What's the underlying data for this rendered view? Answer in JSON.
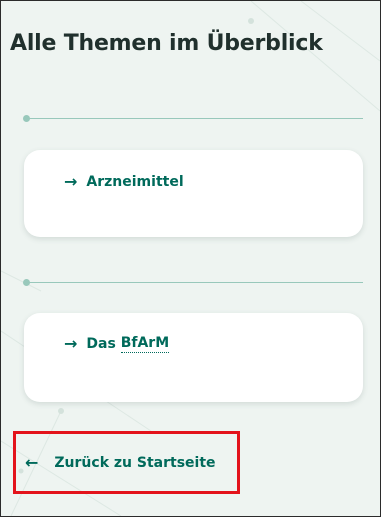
{
  "title": "Alle Themen im Überblick",
  "cards": [
    {
      "arrow": "→",
      "label": "Arzneimittel"
    },
    {
      "arrow": "→",
      "label": "Das ",
      "abbr": "BfArM"
    }
  ],
  "back_link": {
    "arrow": "←",
    "label": "Zurück zu Startseite"
  },
  "colors": {
    "background": "#eef4f1",
    "link": "#006a5b",
    "title": "#20302d",
    "divider": "#98c8bb",
    "highlight": "#e3131b"
  }
}
